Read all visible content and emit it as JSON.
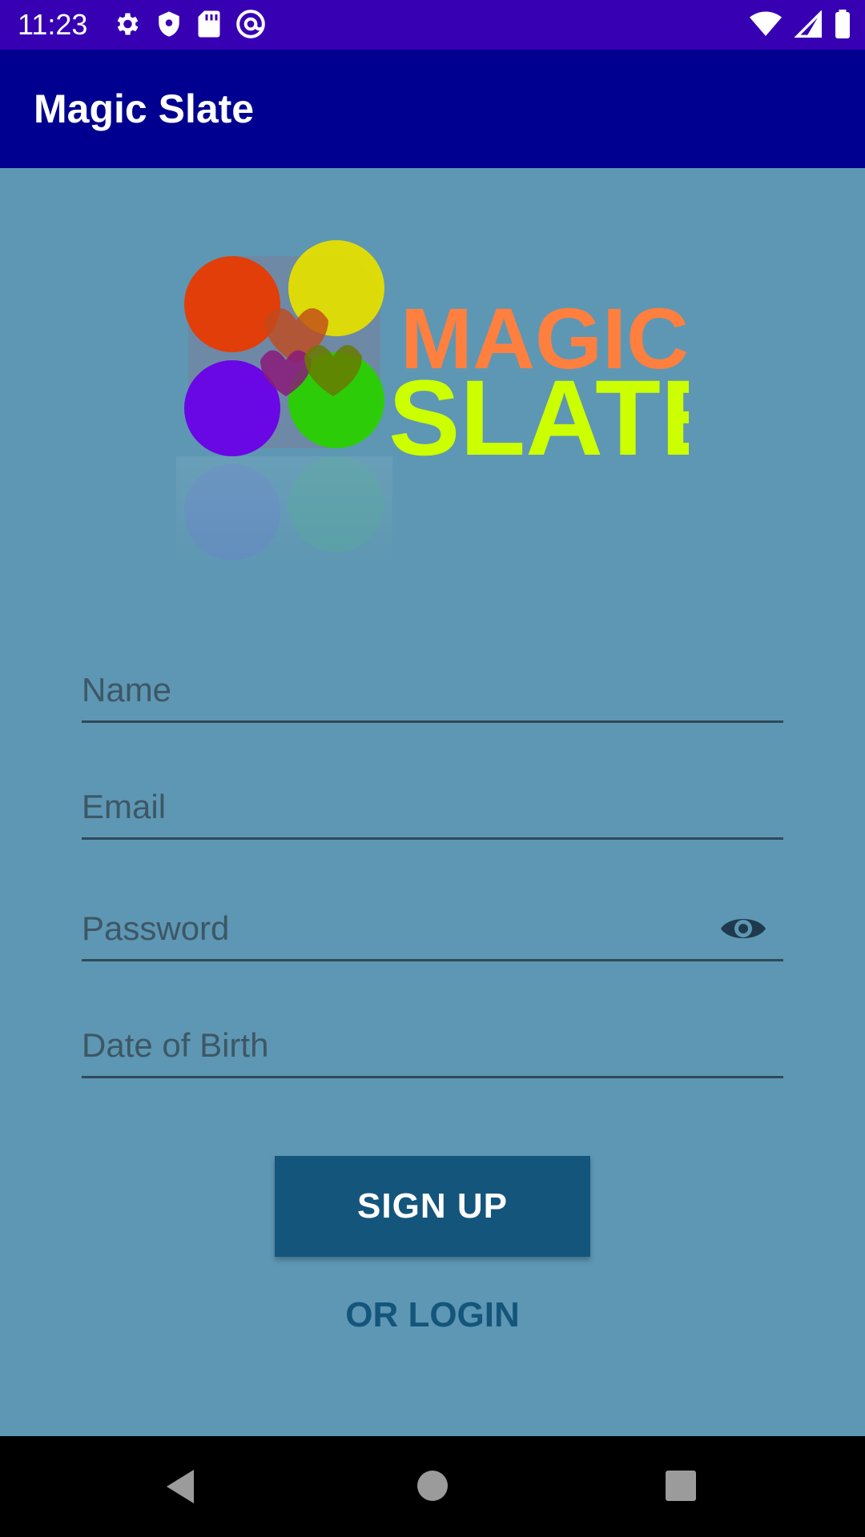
{
  "status_bar": {
    "time": "11:23",
    "left_icons": [
      "gear-icon",
      "shield-icon",
      "sd-card-icon",
      "at-sign-icon"
    ],
    "right_icons": [
      "wifi-icon",
      "signal-icon",
      "battery-icon"
    ],
    "background": "#3700b3"
  },
  "app_bar": {
    "title": "Magic Slate",
    "background": "#000090"
  },
  "logo": {
    "line1": "MAGIC",
    "line2": "SLATE",
    "line1_color": "#ff7f3f",
    "line2_color": "#ccff00"
  },
  "form": {
    "name_placeholder": "Name",
    "email_placeholder": "Email",
    "password_placeholder": "Password",
    "dob_placeholder": "Date of Birth"
  },
  "buttons": {
    "signup_label": "SIGN UP",
    "login_label": "OR LOGIN"
  },
  "colors": {
    "background": "#5e97b3",
    "primary_button": "#14557c"
  },
  "nav": {
    "icons": [
      "back-icon",
      "home-icon",
      "recents-icon"
    ]
  }
}
